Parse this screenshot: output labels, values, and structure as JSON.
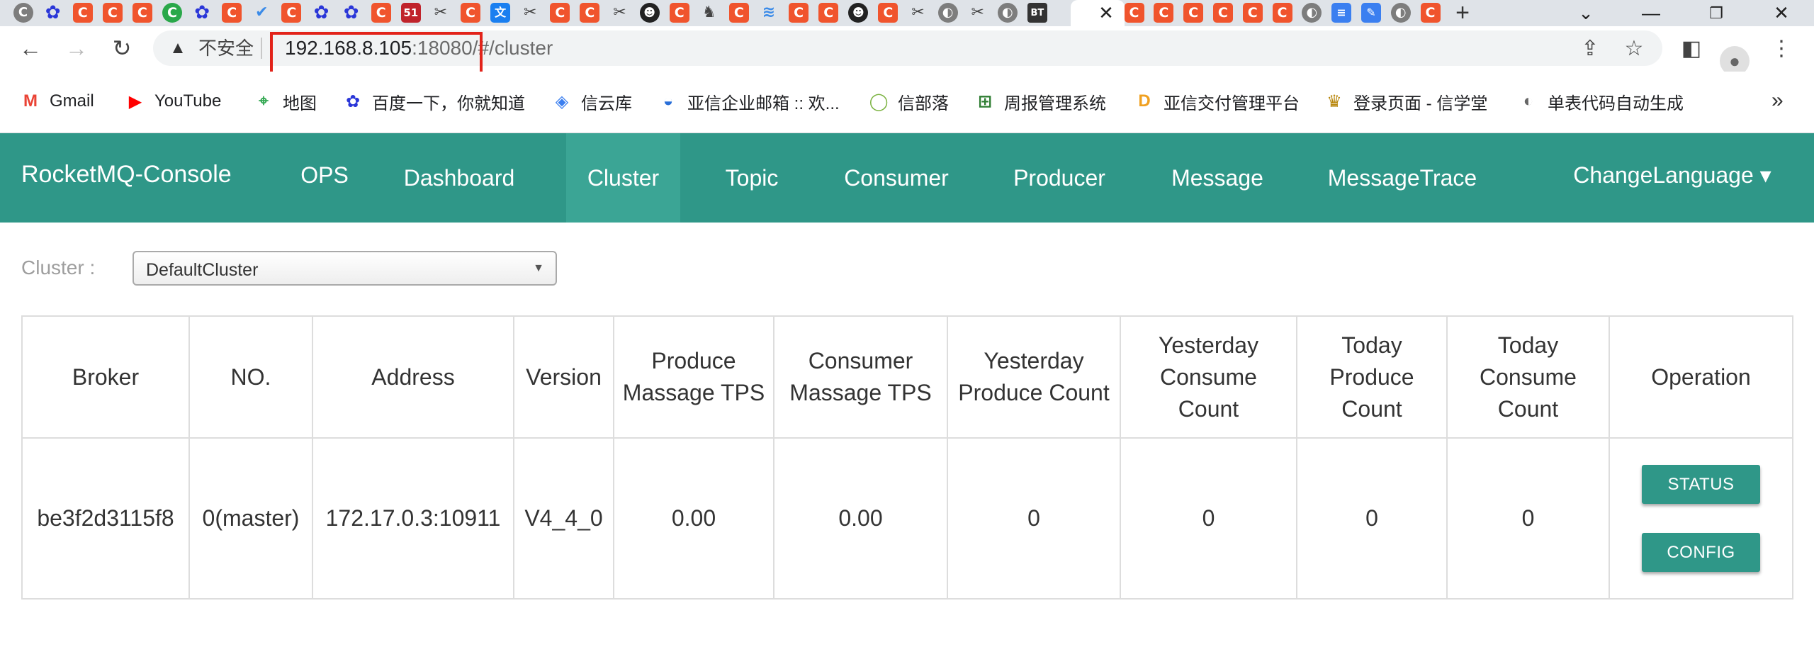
{
  "browser": {
    "tabs": [
      {
        "icon": "gray",
        "glyph": "C"
      },
      {
        "icon": "paw",
        "glyph": "✿"
      },
      {
        "icon": "c",
        "glyph": "C"
      },
      {
        "icon": "c",
        "glyph": "C"
      },
      {
        "icon": "c",
        "glyph": "C"
      },
      {
        "icon": "green",
        "glyph": "C"
      },
      {
        "icon": "paw",
        "glyph": "✿"
      },
      {
        "icon": "c",
        "glyph": "C"
      },
      {
        "icon": "check",
        "glyph": "✔"
      },
      {
        "icon": "c",
        "glyph": "C"
      },
      {
        "icon": "paw",
        "glyph": "✿"
      },
      {
        "icon": "paw",
        "glyph": "✿"
      },
      {
        "icon": "c",
        "glyph": "C"
      },
      {
        "icon": "red51",
        "glyph": "51"
      },
      {
        "icon": "scissor",
        "glyph": "✂"
      },
      {
        "icon": "c",
        "glyph": "C"
      },
      {
        "icon": "blue",
        "glyph": "文"
      },
      {
        "icon": "scissor",
        "glyph": "✂"
      },
      {
        "icon": "c",
        "glyph": "C"
      },
      {
        "icon": "c",
        "glyph": "C"
      },
      {
        "icon": "scissor",
        "glyph": "✂"
      },
      {
        "icon": "face",
        "glyph": "☻"
      },
      {
        "icon": "c",
        "glyph": "C"
      },
      {
        "icon": "scissor",
        "glyph": "♞"
      },
      {
        "icon": "c",
        "glyph": "C"
      },
      {
        "icon": "check",
        "glyph": "≋"
      },
      {
        "icon": "c",
        "glyph": "C"
      },
      {
        "icon": "c",
        "glyph": "C"
      },
      {
        "icon": "face",
        "glyph": "☻"
      },
      {
        "icon": "c",
        "glyph": "C"
      },
      {
        "icon": "scissor",
        "glyph": "✂"
      },
      {
        "icon": "gray",
        "glyph": "◐"
      },
      {
        "icon": "scissor",
        "glyph": "✂"
      },
      {
        "icon": "gray",
        "glyph": "◐"
      },
      {
        "icon": "bt",
        "glyph": "BT"
      }
    ],
    "tabs_after": [
      {
        "icon": "c",
        "glyph": "C"
      },
      {
        "icon": "c",
        "glyph": "C"
      },
      {
        "icon": "c",
        "glyph": "C"
      },
      {
        "icon": "c",
        "glyph": "C"
      },
      {
        "icon": "c",
        "glyph": "C"
      },
      {
        "icon": "c",
        "glyph": "C"
      },
      {
        "icon": "gray",
        "glyph": "◐"
      },
      {
        "icon": "doc",
        "glyph": "≡"
      },
      {
        "icon": "doc",
        "glyph": "✎"
      },
      {
        "icon": "gray",
        "glyph": "◐"
      },
      {
        "icon": "c",
        "glyph": "C"
      }
    ],
    "active_close_glyph": "✕",
    "new_tab_glyph": "+",
    "security_label": "不安全",
    "url_host": "192.168.8.105",
    "url_port": ":18080",
    "url_path": "/#/cluster",
    "highlight_color": "#e2231a",
    "bookmarks": [
      {
        "label": "Gmail",
        "icon": "gmail-icon",
        "glyph": "M",
        "color": "#ea4335"
      },
      {
        "label": "YouTube",
        "icon": "youtube-icon",
        "glyph": "▶",
        "color": "#ff0000"
      },
      {
        "label": "地图",
        "icon": "maps-icon",
        "glyph": "⌖",
        "color": "#34a853"
      },
      {
        "label": "百度一下，你就知道",
        "icon": "baidu-icon",
        "glyph": "✿",
        "color": "#2a36d8"
      },
      {
        "label": "信云库",
        "icon": "cloud-icon",
        "glyph": "◈",
        "color": "#3b7ff0"
      },
      {
        "label": "亚信企业邮箱 :: 欢...",
        "icon": "mail-icon",
        "glyph": "◒",
        "color": "#2a6fd8"
      },
      {
        "label": "信部落",
        "icon": "tribe-icon",
        "glyph": "◯",
        "color": "#7cb342"
      },
      {
        "label": "周报管理系统",
        "icon": "report-icon",
        "glyph": "⊞",
        "color": "#2e7d32"
      },
      {
        "label": "亚信交付管理平台",
        "icon": "delivery-icon",
        "glyph": "D",
        "color": "#f0a020"
      },
      {
        "label": "登录页面 - 信学堂",
        "icon": "school-icon",
        "glyph": "♛",
        "color": "#b8860b"
      },
      {
        "label": "单表代码自动生成",
        "icon": "globe-icon",
        "glyph": "◐",
        "color": "#666666"
      }
    ],
    "bookmarks_more": "»"
  },
  "app": {
    "brand": "RocketMQ-Console",
    "accent": "#2f9788",
    "nav": [
      "OPS",
      "Dashboard",
      "Cluster",
      "Topic",
      "Consumer",
      "Producer",
      "Message",
      "MessageTrace"
    ],
    "active_nav": "Cluster",
    "change_language": "ChangeLanguage ▾"
  },
  "cluster": {
    "label": "Cluster :",
    "selected": "DefaultCluster",
    "arrow": "▼"
  },
  "table": {
    "headers": [
      "Broker",
      "NO.",
      "Address",
      "Version",
      "Produce Massage TPS",
      "Consumer Massage TPS",
      "Yesterday Produce Count",
      "Yesterday Consume Count",
      "Today Produce Count",
      "Today Consume Count",
      "Operation"
    ],
    "rows": [
      {
        "broker": "be3f2d3115f8",
        "no": "0(master)",
        "address": "172.17.0.3:10911",
        "version": "V4_4_0",
        "produce_tps": "0.00",
        "consumer_tps": "0.00",
        "yesterday_produce": "0",
        "yesterday_consume": "0",
        "today_produce": "0",
        "today_consume": "0"
      }
    ],
    "buttons": {
      "status": "STATUS",
      "config": "CONFIG"
    }
  }
}
